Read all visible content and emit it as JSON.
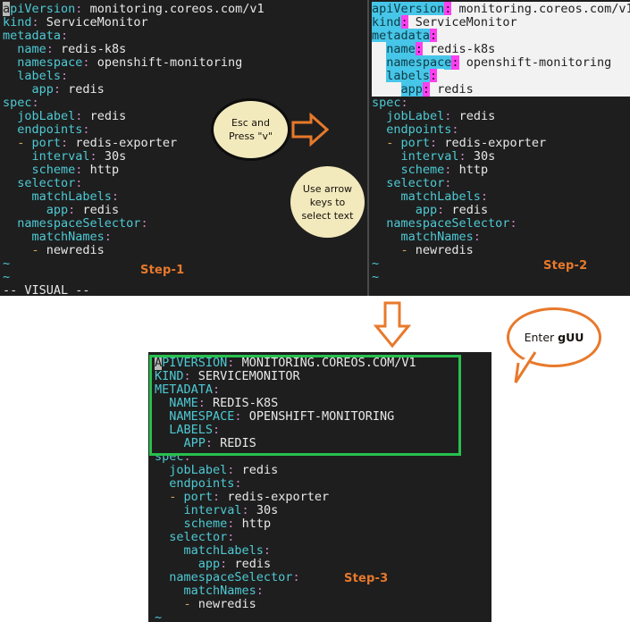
{
  "theme": {
    "terminal_bg": "#1e1e1e",
    "key_color": "#4ec9d4",
    "punct_color": "#c586c0",
    "value_color": "#e8e8e8",
    "accent_orange": "#e8792b",
    "highlight_box_green": "#27c14e",
    "selection_bg": "#f2f2f2",
    "selection_key_bg": "#46c6e8",
    "selection_colon_bg": "#ff3ff0",
    "callout_fill": "#f2e9bd"
  },
  "panel1": {
    "name": "vim-editor-step-1",
    "step_label": "Step-1",
    "status_line": "-- VISUAL --",
    "tilde_lines": [
      "~",
      "~"
    ],
    "lines": [
      {
        "indent": 0,
        "key": "apiVersion",
        "colon": ":",
        "value": " monitoring.coreos.com/v1",
        "cursor_char": "a"
      },
      {
        "indent": 0,
        "key": "kind",
        "colon": ":",
        "value": " ServiceMonitor"
      },
      {
        "indent": 0,
        "key": "metadata",
        "colon": ":",
        "value": ""
      },
      {
        "indent": 2,
        "key": "name",
        "colon": ":",
        "value": " redis-k8s"
      },
      {
        "indent": 2,
        "key": "namespace",
        "colon": ":",
        "value": " openshift-monitoring"
      },
      {
        "indent": 2,
        "key": "labels",
        "colon": ":",
        "value": ""
      },
      {
        "indent": 4,
        "key": "app",
        "colon": ":",
        "value": " redis"
      },
      {
        "indent": 0,
        "key": "spec",
        "colon": ":",
        "value": ""
      },
      {
        "indent": 2,
        "key": "jobLabel",
        "colon": ":",
        "value": " redis"
      },
      {
        "indent": 2,
        "key": "endpoints",
        "colon": ":",
        "value": ""
      },
      {
        "indent": 2,
        "dash": "- ",
        "key": "port",
        "colon": ":",
        "value": " redis-exporter"
      },
      {
        "indent": 4,
        "key": "interval",
        "colon": ":",
        "value": " 30s"
      },
      {
        "indent": 4,
        "key": "scheme",
        "colon": ":",
        "value": " http"
      },
      {
        "indent": 2,
        "key": "selector",
        "colon": ":",
        "value": ""
      },
      {
        "indent": 4,
        "key": "matchLabels",
        "colon": ":",
        "value": ""
      },
      {
        "indent": 6,
        "key": "app",
        "colon": ":",
        "value": " redis"
      },
      {
        "indent": 2,
        "key": "namespaceSelector",
        "colon": ":",
        "value": ""
      },
      {
        "indent": 4,
        "key": "matchNames",
        "colon": ":",
        "value": ""
      },
      {
        "indent": 4,
        "dash": "- ",
        "key": "",
        "colon": "",
        "value": "newredis"
      }
    ]
  },
  "panel2": {
    "name": "vim-editor-step-2",
    "step_label": "Step-2",
    "status_line": "",
    "tilde_lines": [
      "~",
      "~"
    ],
    "selected_line_count": 7,
    "lines": [
      {
        "indent": 0,
        "key": "apiVersion",
        "colon": ":",
        "value": " monitoring.coreos.com/v1",
        "selected": true
      },
      {
        "indent": 0,
        "key": "kind",
        "colon": ":",
        "value": " ServiceMonitor",
        "selected": true
      },
      {
        "indent": 0,
        "key": "metadata",
        "colon": ":",
        "value": "",
        "selected": true
      },
      {
        "indent": 2,
        "key": "name",
        "colon": ":",
        "value": " redis-k8s",
        "selected": true
      },
      {
        "indent": 2,
        "key": "namespace",
        "colon": ":",
        "value": " openshift-monitoring",
        "selected": true
      },
      {
        "indent": 2,
        "key": "labels",
        "colon": ":",
        "value": "",
        "selected": true
      },
      {
        "indent": 4,
        "key": "app",
        "colon": ":",
        "value": " redis",
        "selected": true
      },
      {
        "indent": 0,
        "key": "spec",
        "colon": ":",
        "value": ""
      },
      {
        "indent": 2,
        "key": "jobLabel",
        "colon": ":",
        "value": " redis"
      },
      {
        "indent": 2,
        "key": "endpoints",
        "colon": ":",
        "value": ""
      },
      {
        "indent": 2,
        "dash": "- ",
        "key": "port",
        "colon": ":",
        "value": " redis-exporter"
      },
      {
        "indent": 4,
        "key": "interval",
        "colon": ":",
        "value": " 30s"
      },
      {
        "indent": 4,
        "key": "scheme",
        "colon": ":",
        "value": " http"
      },
      {
        "indent": 2,
        "key": "selector",
        "colon": ":",
        "value": ""
      },
      {
        "indent": 4,
        "key": "matchLabels",
        "colon": ":",
        "value": ""
      },
      {
        "indent": 6,
        "key": "app",
        "colon": ":",
        "value": " redis"
      },
      {
        "indent": 2,
        "key": "namespaceSelector",
        "colon": ":",
        "value": ""
      },
      {
        "indent": 4,
        "key": "matchNames",
        "colon": ":",
        "value": ""
      },
      {
        "indent": 4,
        "dash": "- ",
        "key": "",
        "colon": "",
        "value": "newredis"
      }
    ]
  },
  "panel3": {
    "name": "vim-editor-step-3",
    "step_label": "Step-3",
    "status_line": "",
    "tilde_lines": [
      "~"
    ],
    "highlight_box_line_count": 7,
    "lines": [
      {
        "indent": 0,
        "key": "APIVERSION",
        "colon": ":",
        "value": " MONITORING.COREOS.COM/V1",
        "cursor_char": "A"
      },
      {
        "indent": 0,
        "key": "KIND",
        "colon": ":",
        "value": " SERVICEMONITOR"
      },
      {
        "indent": 0,
        "key": "METADATA",
        "colon": ":",
        "value": ""
      },
      {
        "indent": 2,
        "key": "NAME",
        "colon": ":",
        "value": " REDIS-K8S"
      },
      {
        "indent": 2,
        "key": "NAMESPACE",
        "colon": ":",
        "value": " OPENSHIFT-MONITORING"
      },
      {
        "indent": 2,
        "key": "LABELS",
        "colon": ":",
        "value": ""
      },
      {
        "indent": 4,
        "key": "APP",
        "colon": ":",
        "value": " REDIS"
      },
      {
        "indent": 0,
        "key": "spec",
        "colon": ":",
        "value": ""
      },
      {
        "indent": 2,
        "key": "jobLabel",
        "colon": ":",
        "value": " redis"
      },
      {
        "indent": 2,
        "key": "endpoints",
        "colon": ":",
        "value": ""
      },
      {
        "indent": 2,
        "dash": "- ",
        "key": "port",
        "colon": ":",
        "value": " redis-exporter"
      },
      {
        "indent": 4,
        "key": "interval",
        "colon": ":",
        "value": " 30s"
      },
      {
        "indent": 4,
        "key": "scheme",
        "colon": ":",
        "value": " http"
      },
      {
        "indent": 2,
        "key": "selector",
        "colon": ":",
        "value": ""
      },
      {
        "indent": 4,
        "key": "matchLabels",
        "colon": ":",
        "value": ""
      },
      {
        "indent": 6,
        "key": "app",
        "colon": ":",
        "value": " redis"
      },
      {
        "indent": 2,
        "key": "namespaceSelector",
        "colon": ":",
        "value": ""
      },
      {
        "indent": 4,
        "key": "matchNames",
        "colon": ":",
        "value": ""
      },
      {
        "indent": 4,
        "dash": "- ",
        "key": "",
        "colon": "",
        "value": "newredis"
      }
    ]
  },
  "callouts": {
    "esc": {
      "name": "callout-esc-and-press-v",
      "line1": "Esc and",
      "line2": "Press \"v\""
    },
    "arrow_keys": {
      "name": "callout-use-arrow-keys",
      "line1": "Use arrow",
      "line2": "keys to",
      "line3": "select text"
    },
    "enter": {
      "name": "callout-enter-guu",
      "prefix": "Enter ",
      "command": "gUU"
    }
  },
  "arrows": {
    "right": {
      "name": "arrow-right-icon"
    },
    "down": {
      "name": "arrow-down-icon"
    }
  }
}
